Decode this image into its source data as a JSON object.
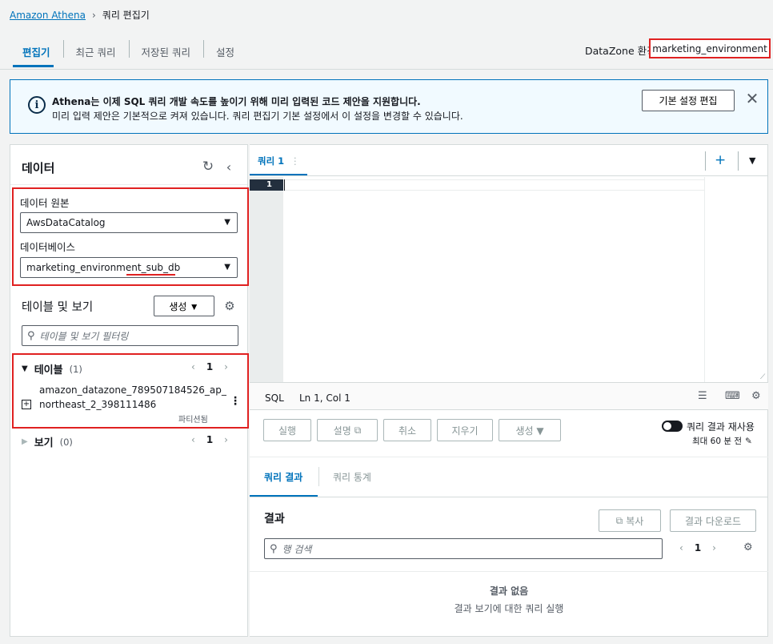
{
  "breadcrumb": {
    "root": "Amazon Athena",
    "separator": "›",
    "current": "쿼리 편집기"
  },
  "top_tabs": [
    {
      "label": "편집기",
      "active": true
    },
    {
      "label": "최근 쿼리",
      "active": false
    },
    {
      "label": "저장된 쿼리",
      "active": false
    },
    {
      "label": "설정",
      "active": false
    }
  ],
  "datazone": {
    "label": "DataZone 환경",
    "value": "marketing_environment"
  },
  "flash": {
    "icon": "info-icon",
    "title": "Athena는 이제 SQL 쿼리 개발 속도를 높이기 위해 미리 입력된 코드 제안을 지원합니다.",
    "description": "미리 입력 제안은 기본적으로 켜져 있습니다. 쿼리 편집기 기본 설정에서 이 설정을 변경할 수 있습니다.",
    "button": "기본 설정 편집"
  },
  "data_panel": {
    "title": "데이터",
    "source_label": "데이터 원본",
    "source_value": "AwsDataCatalog",
    "database_label": "데이터베이스",
    "database_value": "marketing_environment_sub_db",
    "tables_views_title": "테이블 및 보기",
    "create_label": "생성 ▼",
    "filter_placeholder": "테이블 및 보기 필터링",
    "tables": {
      "label": "테이블",
      "count": "(1)",
      "page": "1",
      "items": [
        {
          "name": "amazon_datazone_789507184526_ap_northeast_2_398111486",
          "badge": "파티션됨"
        }
      ]
    },
    "views": {
      "label": "보기",
      "count": "(0)",
      "page": "1"
    }
  },
  "editor": {
    "tab_label": "쿼리 1",
    "line_number": "1",
    "status_lang": "SQL",
    "cursor_position": "Ln 1, Col 1",
    "buttons": {
      "run": "실행",
      "explain": "설명",
      "cancel": "취소",
      "clear": "지우기",
      "generate": "생성 ▼"
    },
    "reuse_label": "쿼리 결과 재사용",
    "reuse_sub": "최대 60 분 전"
  },
  "results": {
    "tabs": [
      "쿼리 결과",
      "쿼리 통계"
    ],
    "title": "결과",
    "copy_label": "복사",
    "download_label": "결과 다운로드",
    "search_placeholder": "행 검색",
    "page": "1",
    "empty_title": "결과 없음",
    "empty_sub": "결과 보기에 대한 쿼리 실행"
  },
  "colors": {
    "accent": "#0073bb",
    "highlight": "#e02121",
    "dark": "#232f3e"
  }
}
